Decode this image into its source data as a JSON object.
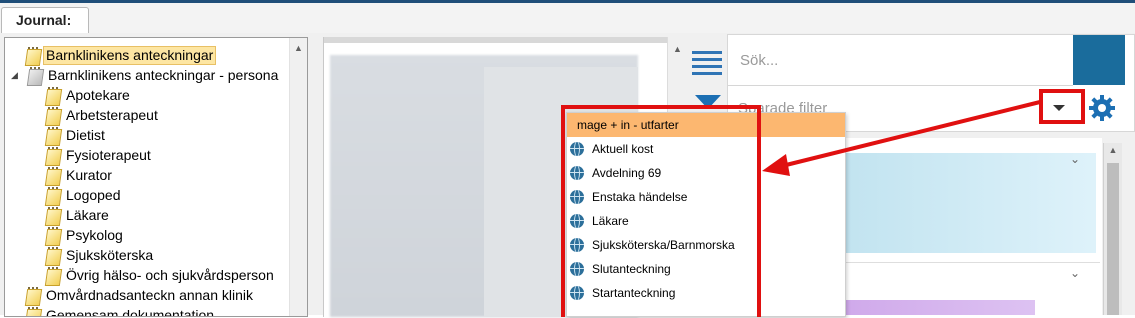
{
  "tab": {
    "label": "Journal:"
  },
  "tree": {
    "items": [
      {
        "label": "Barnklinikens anteckningar",
        "selected": true,
        "expander": ""
      },
      {
        "label": "Barnklinikens anteckningar - persona",
        "selected": false,
        "expander": "◢"
      },
      {
        "label": "Apotekare"
      },
      {
        "label": "Arbetsterapeut"
      },
      {
        "label": "Dietist"
      },
      {
        "label": "Fysioterapeut"
      },
      {
        "label": "Kurator"
      },
      {
        "label": "Logoped"
      },
      {
        "label": "Läkare"
      },
      {
        "label": "Psykolog"
      },
      {
        "label": "Sjuksköterska"
      },
      {
        "label": "Övrig hälso- och sjukvårdsperson"
      },
      {
        "label": "Omvårdnadsanteckn annan klinik"
      },
      {
        "label": "Gemensam dokumentation"
      }
    ]
  },
  "filter": {
    "search_placeholder": "Sök...",
    "saved_filters_placeholder": "Sparade filter"
  },
  "dropdown": {
    "header": "mage + in - utfarter",
    "items": [
      {
        "label": "Aktuell kost",
        "icon": "globe-icon"
      },
      {
        "label": "Avdelning 69",
        "icon": "globe-icon"
      },
      {
        "label": "Enstaka händelse",
        "icon": "globe-icon"
      },
      {
        "label": "Läkare",
        "icon": "globe-icon"
      },
      {
        "label": "Sjuksköterska/Barnmorska",
        "icon": "globe-icon"
      },
      {
        "label": "Slutanteckning",
        "icon": "globe-icon"
      },
      {
        "label": "Startanteckning",
        "icon": "globe-icon"
      }
    ]
  },
  "colors": {
    "accent": "#1a6c9c",
    "annotation_red": "#e01010",
    "dropdown_header": "#fcb770",
    "tree_selected": "#fde6a3"
  }
}
